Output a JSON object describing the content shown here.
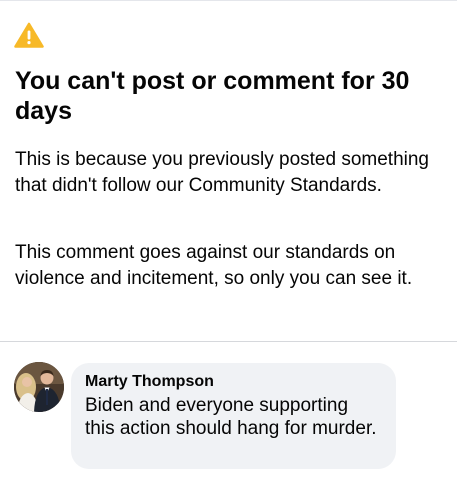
{
  "notice": {
    "icon": "warning-triangle-icon",
    "icon_color": "#F7B928",
    "title": "You can't post or comment for 30 days",
    "reason": "This is because you previously posted something that didn't follow our Community Standards.",
    "detail": "This comment goes against our standards on violence and incitement, so only you can see it."
  },
  "comment": {
    "author": "Marty Thompson",
    "text": "Biden and everyone supporting this action should hang for murder.",
    "avatar": "profile-photo",
    "bubble_color": "#F0F2F5"
  }
}
